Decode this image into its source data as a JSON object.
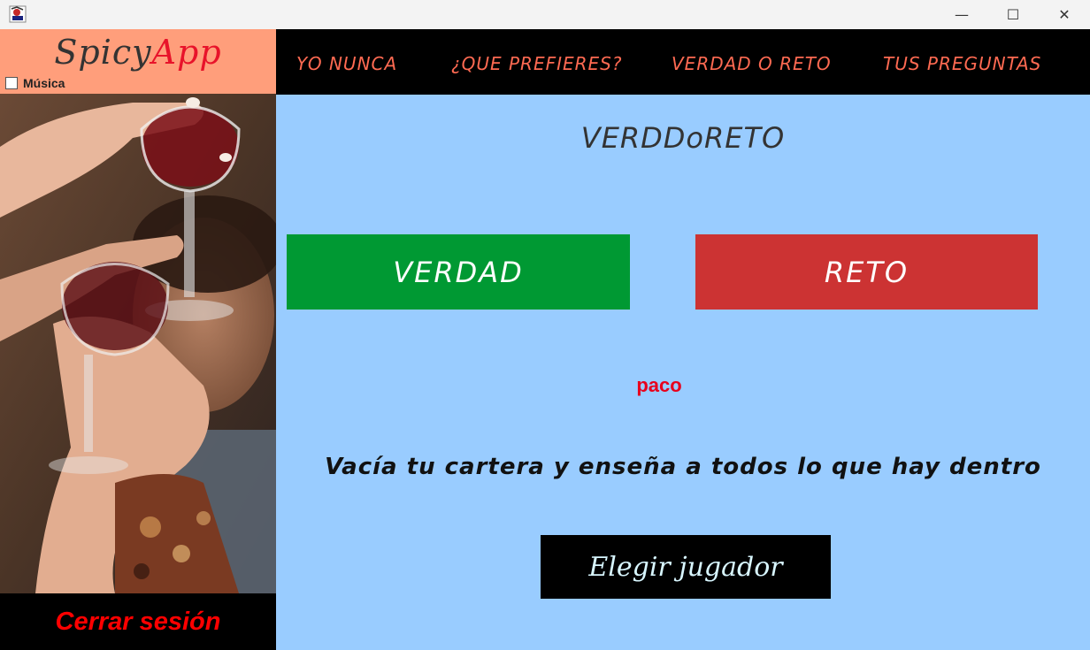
{
  "window": {
    "minimize_glyph": "—",
    "maximize_glyph": "☐",
    "close_glyph": "✕"
  },
  "sidebar": {
    "logo_part1": "Spicy",
    "logo_part2": "App",
    "music_label": "Música",
    "music_checked": false,
    "logout_label": "Cerrar sesión"
  },
  "nav": {
    "items": [
      {
        "label": "YO NUNCA"
      },
      {
        "label": "¿QUE PREFIERES?"
      },
      {
        "label": "VERDAD O RETO"
      },
      {
        "label": "TUS PREGUNTAS"
      }
    ]
  },
  "main": {
    "title": "VERDDoRETO",
    "truth_button": "VERDAD",
    "dare_button": "RETO",
    "player_name": "paco",
    "question": "Vacía tu cartera y enseña a todos lo que hay dentro",
    "choose_player_button": "Elegir jugador"
  },
  "colors": {
    "logo_bg": "#ff9e7b",
    "nav_text": "#ff6a52",
    "main_bg": "#99ccff",
    "truth_bg": "#009933",
    "dare_bg": "#cc3333",
    "player_name": "#e8001c",
    "logout_text": "#ff0000"
  },
  "icons": {
    "app_icon": "java-app-icon",
    "photo": "friends-toasting-wine-glasses-photo"
  }
}
